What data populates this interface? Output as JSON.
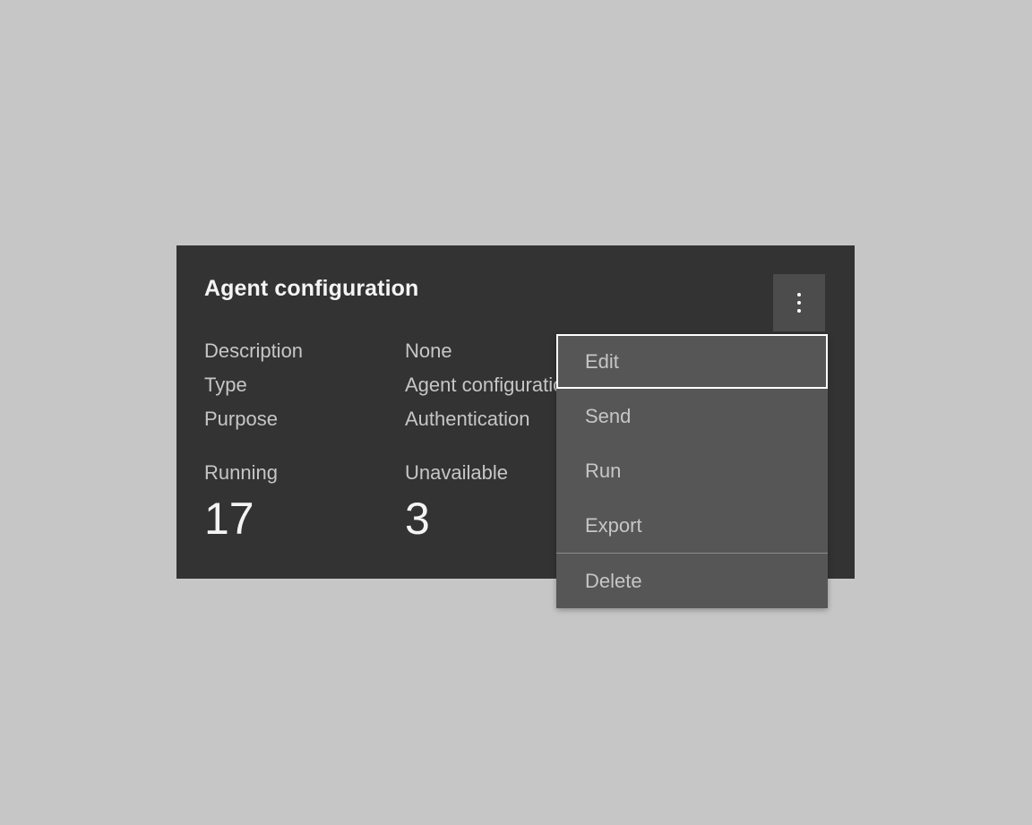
{
  "theme": {
    "page_background": "#c6c6c6",
    "card_background": "#333333",
    "menu_background": "#565656",
    "button_background": "#4c4c4c",
    "text_primary": "#f4f4f4",
    "text_secondary": "#c6c6c6",
    "focus_border": "#ffffff",
    "divider": "#8d8d8d"
  },
  "card": {
    "title": "Agent configuration",
    "overflow_button": {
      "icon": "overflow-menu-vertical-icon",
      "label": "⋮"
    },
    "details": [
      {
        "label": "Description",
        "value": "None"
      },
      {
        "label": "Type",
        "value": "Agent configuration"
      },
      {
        "label": "Purpose",
        "value": "Authentication"
      }
    ],
    "stats": [
      {
        "label": "Running",
        "value": "17"
      },
      {
        "label": "Unavailable",
        "value": "3"
      }
    ]
  },
  "menu": {
    "items": [
      {
        "label": "Edit",
        "selected": true
      },
      {
        "label": "Send",
        "selected": false
      },
      {
        "label": "Run",
        "selected": false
      },
      {
        "label": "Export",
        "selected": false
      }
    ],
    "danger_items": [
      {
        "label": "Delete",
        "selected": false
      }
    ]
  }
}
